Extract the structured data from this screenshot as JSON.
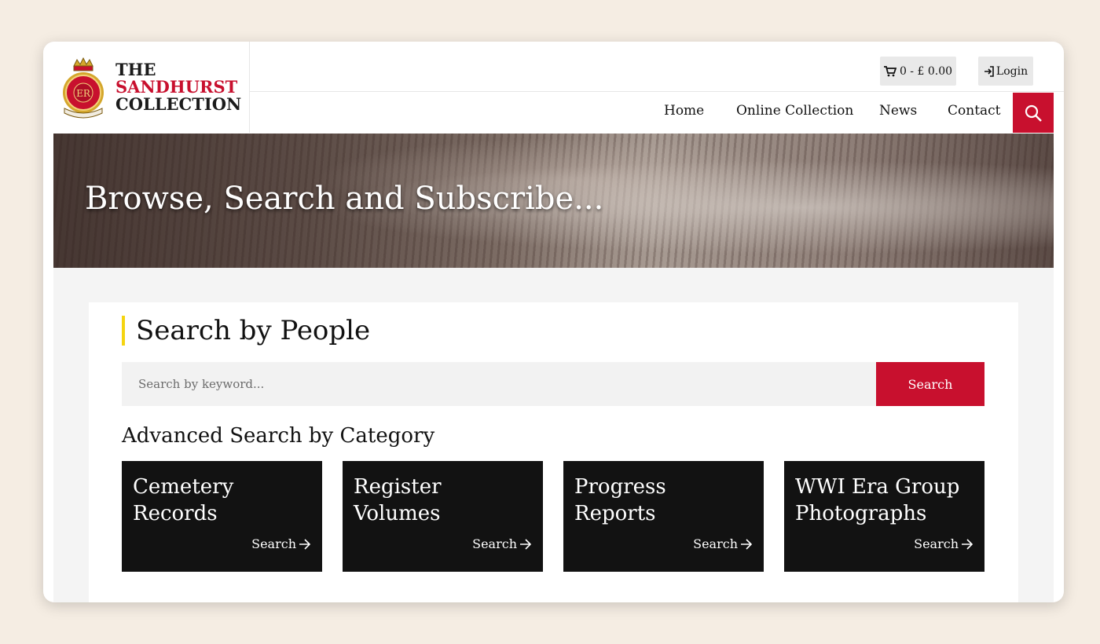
{
  "logo": {
    "line1": "THE",
    "line2": "SANDHURST",
    "line3": "COLLECTION"
  },
  "topbar": {
    "cart_label": "0 - £ 0.00",
    "login_label": "Login"
  },
  "nav": {
    "items": [
      {
        "label": "Home"
      },
      {
        "label": "Online Collection"
      },
      {
        "label": "News"
      },
      {
        "label": "Contact"
      }
    ]
  },
  "hero": {
    "title": "Browse, Search and Subscribe..."
  },
  "search": {
    "title": "Search by People",
    "placeholder": "Search by keyword...",
    "button_label": "Search"
  },
  "advanced": {
    "title": "Advanced Search by Category",
    "cards": [
      {
        "title": "Cemetery Records",
        "link": "Search"
      },
      {
        "title": "Register Volumes",
        "link": "Search"
      },
      {
        "title": "Progress Reports",
        "link": "Search"
      },
      {
        "title": "WWI Era Group Photographs",
        "link": "Search"
      }
    ]
  },
  "colors": {
    "brand_red": "#c8102e",
    "accent_yellow": "#f5d410",
    "card_bg": "#121212",
    "page_bg": "#f5ede3"
  },
  "icons": {
    "cart": "cart-icon",
    "login": "login-icon",
    "search": "search-icon",
    "arrow": "arrow-right-icon",
    "crest": "crest-logo-icon"
  }
}
